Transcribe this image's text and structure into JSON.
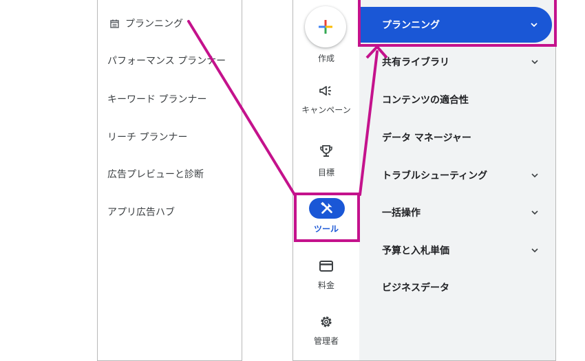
{
  "submenu": {
    "header": "プランニング",
    "items": [
      "パフォーマンス プランナー",
      "キーワード プランナー",
      "リーチ プランナー",
      "広告プレビューと診断",
      "アプリ広告ハブ"
    ]
  },
  "rail": {
    "create": "作成",
    "campaigns": "キャンペーン",
    "goals": "目標",
    "tools": "ツール",
    "billing": "料金",
    "admin": "管理者"
  },
  "menu": {
    "items": [
      {
        "label": "プランニング",
        "expanded": true
      },
      {
        "label": "共有ライブラリ",
        "expanded": false
      },
      {
        "label": "コンテンツの適合性"
      },
      {
        "label": "データ マネージャー"
      },
      {
        "label": "トラブルシューティング",
        "expanded": false
      },
      {
        "label": "一括操作",
        "expanded": false
      },
      {
        "label": "予算と入札単価",
        "expanded": false
      },
      {
        "label": "ビジネスデータ"
      }
    ]
  },
  "colors": {
    "accent": "#1a57d6",
    "highlight": "#c4128c",
    "menu_background": "#f1f3f4"
  }
}
